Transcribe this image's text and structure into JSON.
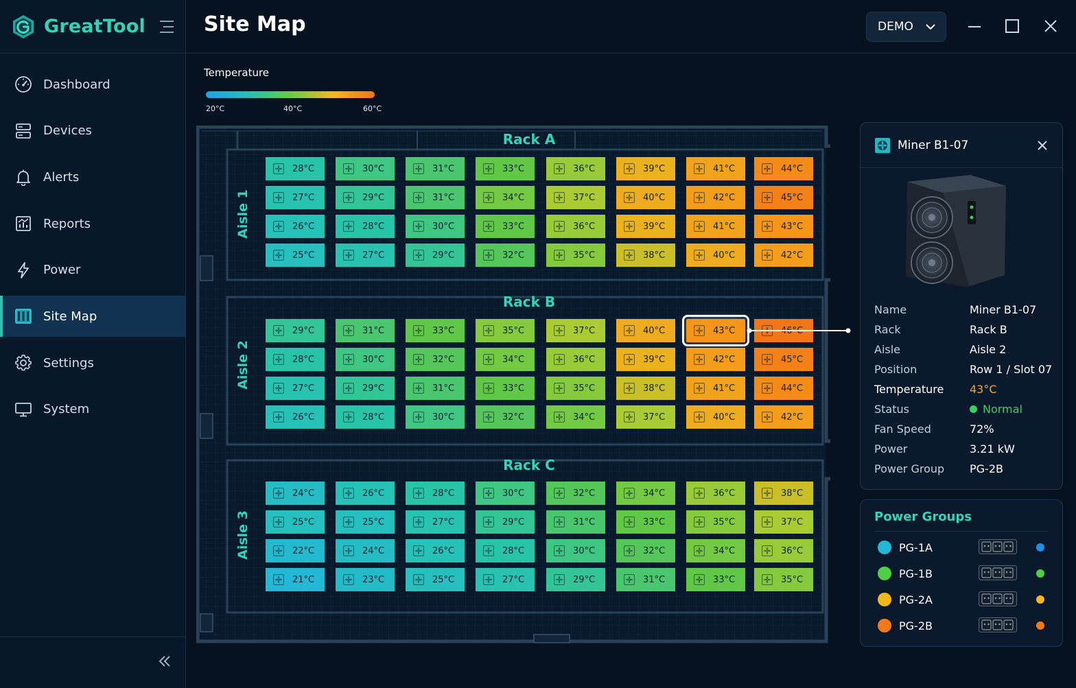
{
  "app": {
    "name": "GreatTool"
  },
  "nav": {
    "items": [
      {
        "label": "Dashboard",
        "icon": "gauge-icon"
      },
      {
        "label": "Devices",
        "icon": "server-icon"
      },
      {
        "label": "Alerts",
        "icon": "bell-icon"
      },
      {
        "label": "Reports",
        "icon": "chart-icon"
      },
      {
        "label": "Power",
        "icon": "bolt-icon"
      },
      {
        "label": "Site Map",
        "icon": "map-icon",
        "active": true
      },
      {
        "label": "Settings",
        "icon": "gear-icon"
      },
      {
        "label": "System",
        "icon": "monitor-icon"
      }
    ]
  },
  "header": {
    "title": "Site Map",
    "site_select": "DEMO"
  },
  "legend": {
    "title": "Temperature",
    "ticks": [
      "20°C",
      "40°C",
      "60°C"
    ]
  },
  "site_map": {
    "racks": [
      {
        "name": "Rack A",
        "aisle": "Aisle 1",
        "rows": [
          [
            28,
            30,
            31,
            33,
            36,
            39,
            41,
            44
          ],
          [
            27,
            29,
            31,
            34,
            37,
            40,
            42,
            45
          ],
          [
            26,
            28,
            30,
            33,
            36,
            39,
            41,
            43
          ],
          [
            25,
            27,
            29,
            32,
            35,
            38,
            40,
            42
          ]
        ]
      },
      {
        "name": "Rack B",
        "aisle": "Aisle 2",
        "rows": [
          [
            29,
            31,
            33,
            35,
            37,
            40,
            43,
            46
          ],
          [
            28,
            30,
            32,
            34,
            36,
            39,
            42,
            45
          ],
          [
            27,
            29,
            31,
            33,
            35,
            38,
            41,
            44
          ],
          [
            26,
            28,
            30,
            32,
            34,
            37,
            40,
            42
          ]
        ]
      },
      {
        "name": "Rack C",
        "aisle": "Aisle 3",
        "rows": [
          [
            24,
            26,
            28,
            30,
            32,
            34,
            36,
            38
          ],
          [
            25,
            25,
            27,
            29,
            31,
            33,
            35,
            37
          ],
          [
            22,
            24,
            26,
            28,
            30,
            32,
            34,
            36
          ],
          [
            21,
            23,
            25,
            27,
            29,
            31,
            33,
            35
          ]
        ]
      }
    ],
    "selected": {
      "rack": 1,
      "row": 0,
      "slot": 6
    },
    "temp_unit": "°C"
  },
  "detail": {
    "title": "Miner B1-07",
    "fields": [
      {
        "key": "Name",
        "value": "Miner B1-07"
      },
      {
        "key": "Rack",
        "value": "Rack B"
      },
      {
        "key": "Aisle",
        "value": "Aisle 2"
      },
      {
        "key": "Position",
        "value": "Row 1 / Slot 07"
      },
      {
        "key": "Temperature",
        "value": "43°C",
        "color": "#f5a623"
      },
      {
        "key": "Status",
        "value": "Normal",
        "color": "#39d05e"
      },
      {
        "key": "Fan Speed",
        "value": "72%"
      },
      {
        "key": "Power",
        "value": "3.21 kW"
      },
      {
        "key": "Power Group",
        "value": "PG-2B"
      }
    ]
  },
  "power_groups": {
    "title": "Power Groups",
    "items": [
      {
        "name": "PG-1A",
        "color": "#22b8d6",
        "status_color": "#1e90e8"
      },
      {
        "name": "PG-1B",
        "color": "#4fcf45",
        "status_color": "#4fcf45"
      },
      {
        "name": "PG-2A",
        "color": "#f2b71c",
        "status_color": "#f2b71c"
      },
      {
        "name": "PG-2B",
        "color": "#f27a18",
        "status_color": "#f27a18"
      }
    ]
  }
}
